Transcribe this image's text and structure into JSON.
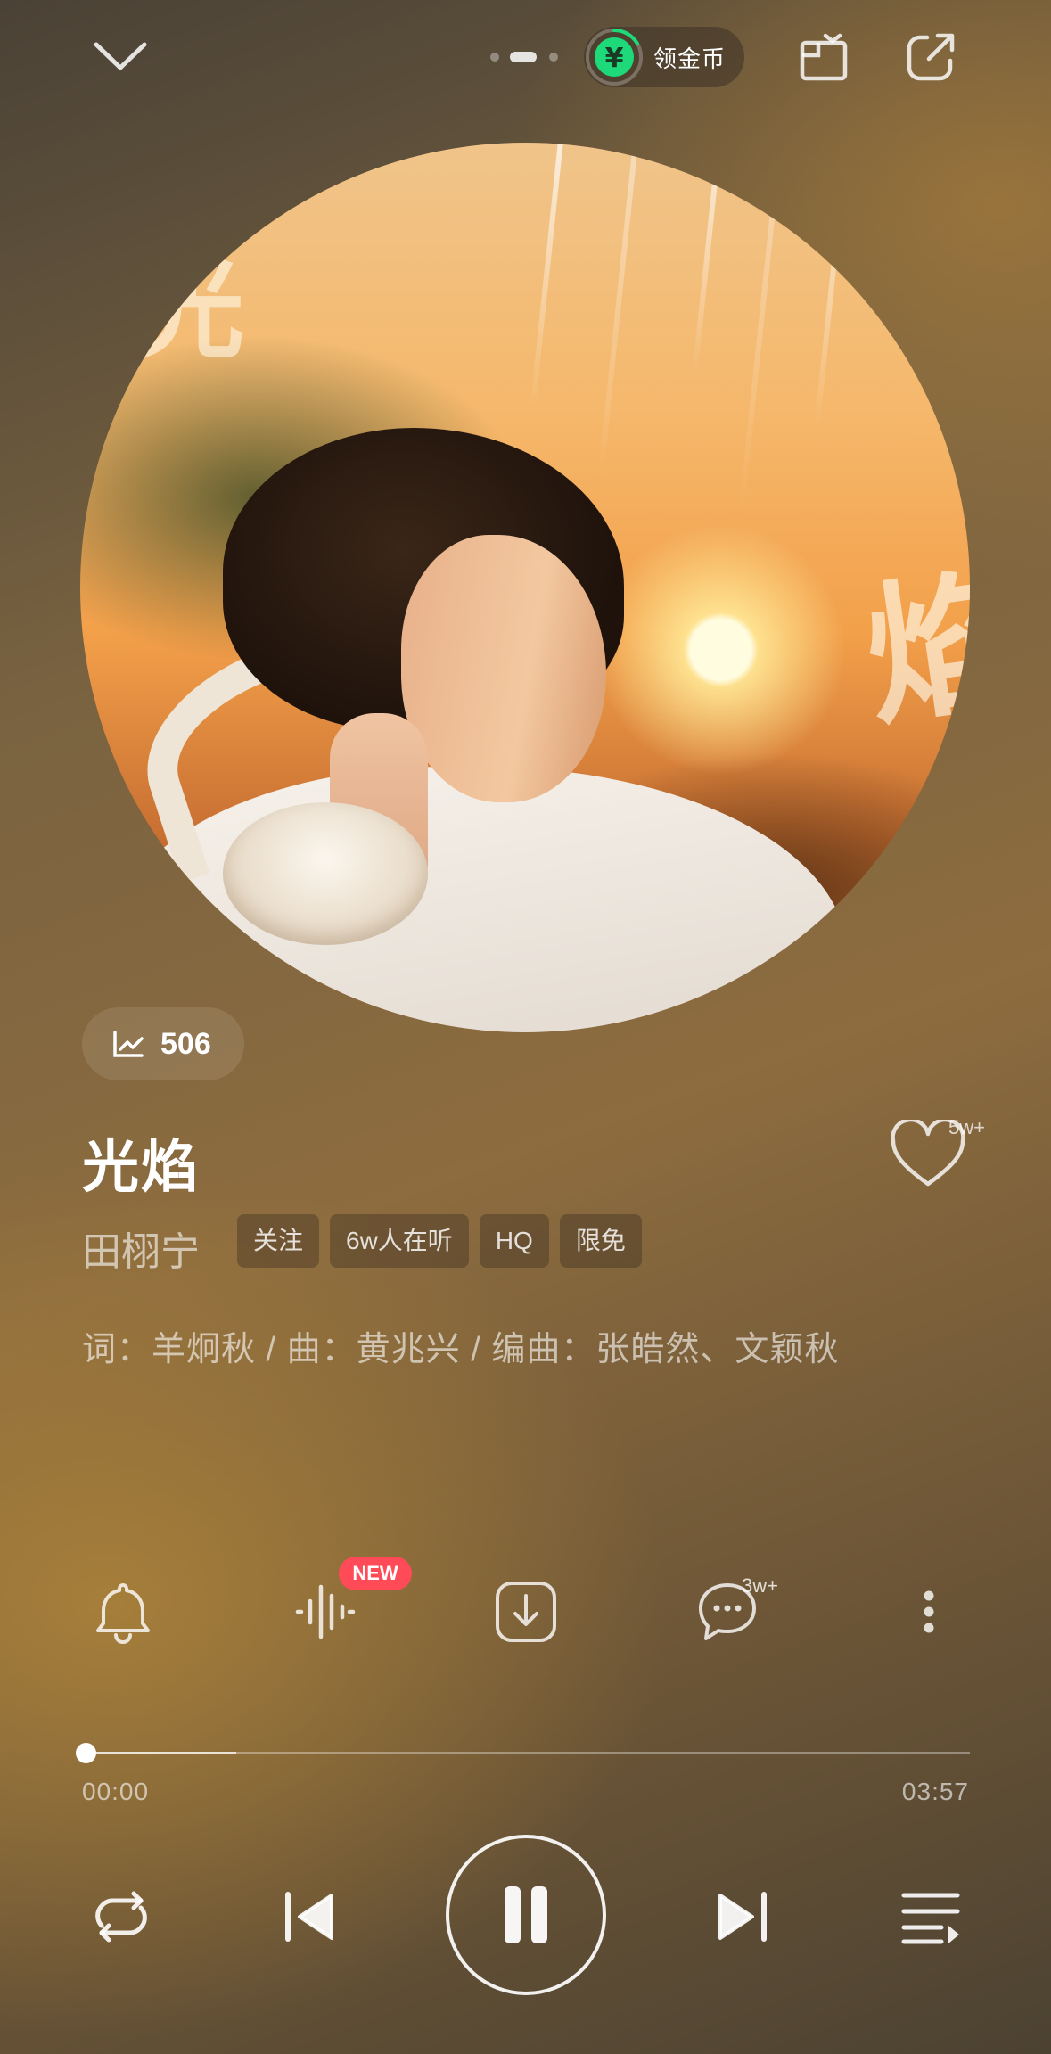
{
  "header": {
    "coin_label": "领金币",
    "coin_symbol": "¥",
    "colors": {
      "coin_green": "#1ed97a"
    },
    "icons": [
      "chevron-down-icon",
      "page-dots",
      "coin-icon",
      "tv-cast-icon",
      "share-icon"
    ]
  },
  "album": {
    "title_glyphs": [
      "光",
      "焰"
    ]
  },
  "trend": {
    "icon": "trend-chart-icon",
    "value": "506"
  },
  "song": {
    "title": "光焰",
    "artist": "田栩宁",
    "like_count": "5w+",
    "tags": [
      "关注",
      "6w人在听",
      "HQ",
      "限免"
    ],
    "credits": "词：羊炯秋 / 曲：黄兆兴 / 编曲：张皓然、文颖秋"
  },
  "actions": {
    "icons": [
      "bell-icon",
      "waveform-icon",
      "download-icon",
      "comment-icon",
      "more-vertical-icon"
    ],
    "new_badge": "NEW",
    "comment_count": "3w+",
    "colors": {
      "badge": "#ff4a58"
    }
  },
  "progress": {
    "elapsed": "00:00",
    "duration": "03:57",
    "played_fraction": 0.0,
    "buffered_fraction": 0.17
  },
  "controls": {
    "icons": [
      "repeat-icon",
      "previous-icon",
      "pause-icon",
      "next-icon",
      "playlist-icon"
    ]
  }
}
